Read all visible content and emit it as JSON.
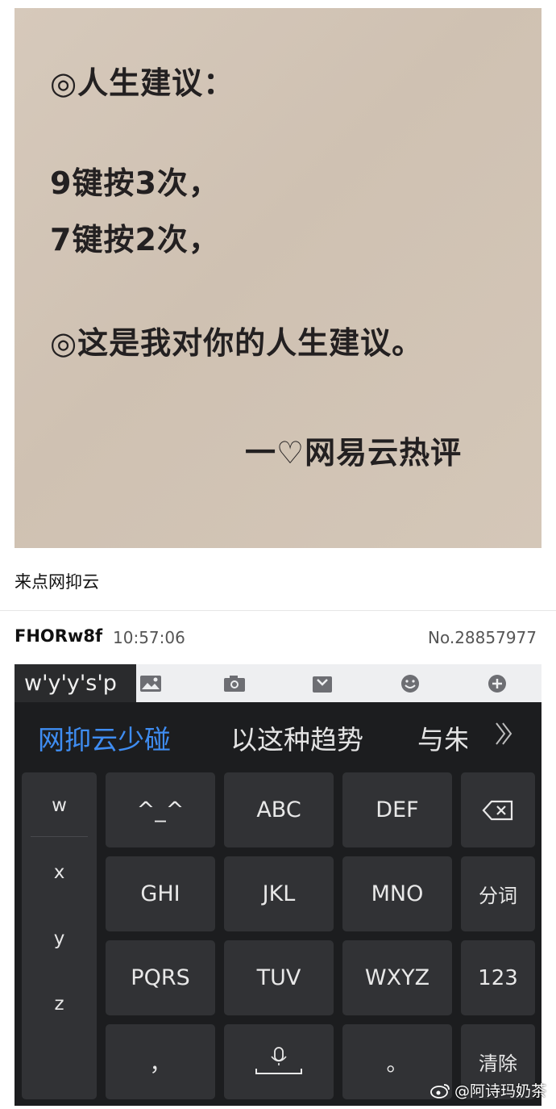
{
  "photo": {
    "line1": "◎人生建议：",
    "line2": "9键按3次，",
    "line3": "7键按2次，",
    "line4": "◎这是我对你的人生建议。",
    "signature": "一♡网易云热评"
  },
  "post": {
    "caption": "来点网抑云",
    "username": "FHORw8f",
    "time": "10:57:06",
    "number": "No.28857977"
  },
  "keyboard": {
    "composing_text": "w'y'y's'p",
    "toolbar_icons": [
      "image-icon",
      "camera-icon",
      "bag-icon",
      "emoji-icon",
      "plus-icon"
    ],
    "candidates": [
      "网抑云少碰",
      "以这种趋势",
      "与朱"
    ],
    "left_column": [
      "w",
      "x",
      "y",
      "z"
    ],
    "keys": {
      "emoticon": "^_^",
      "abc": "ABC",
      "def": "DEF",
      "ghi": "GHI",
      "jkl": "JKL",
      "mno": "MNO",
      "segment": "分词",
      "pqrs": "PQRS",
      "tuv": "TUV",
      "wxyz": "WXYZ",
      "num": "123",
      "comma": "，",
      "period": "。",
      "clear": "清除"
    }
  },
  "watermark": "@阿诗玛奶茶",
  "colors": {
    "candidate_highlight": "#3f8df2",
    "keyboard_bg": "#1c1d1f",
    "key_bg": "#313235",
    "photo_bg": "#d2c5b6"
  }
}
